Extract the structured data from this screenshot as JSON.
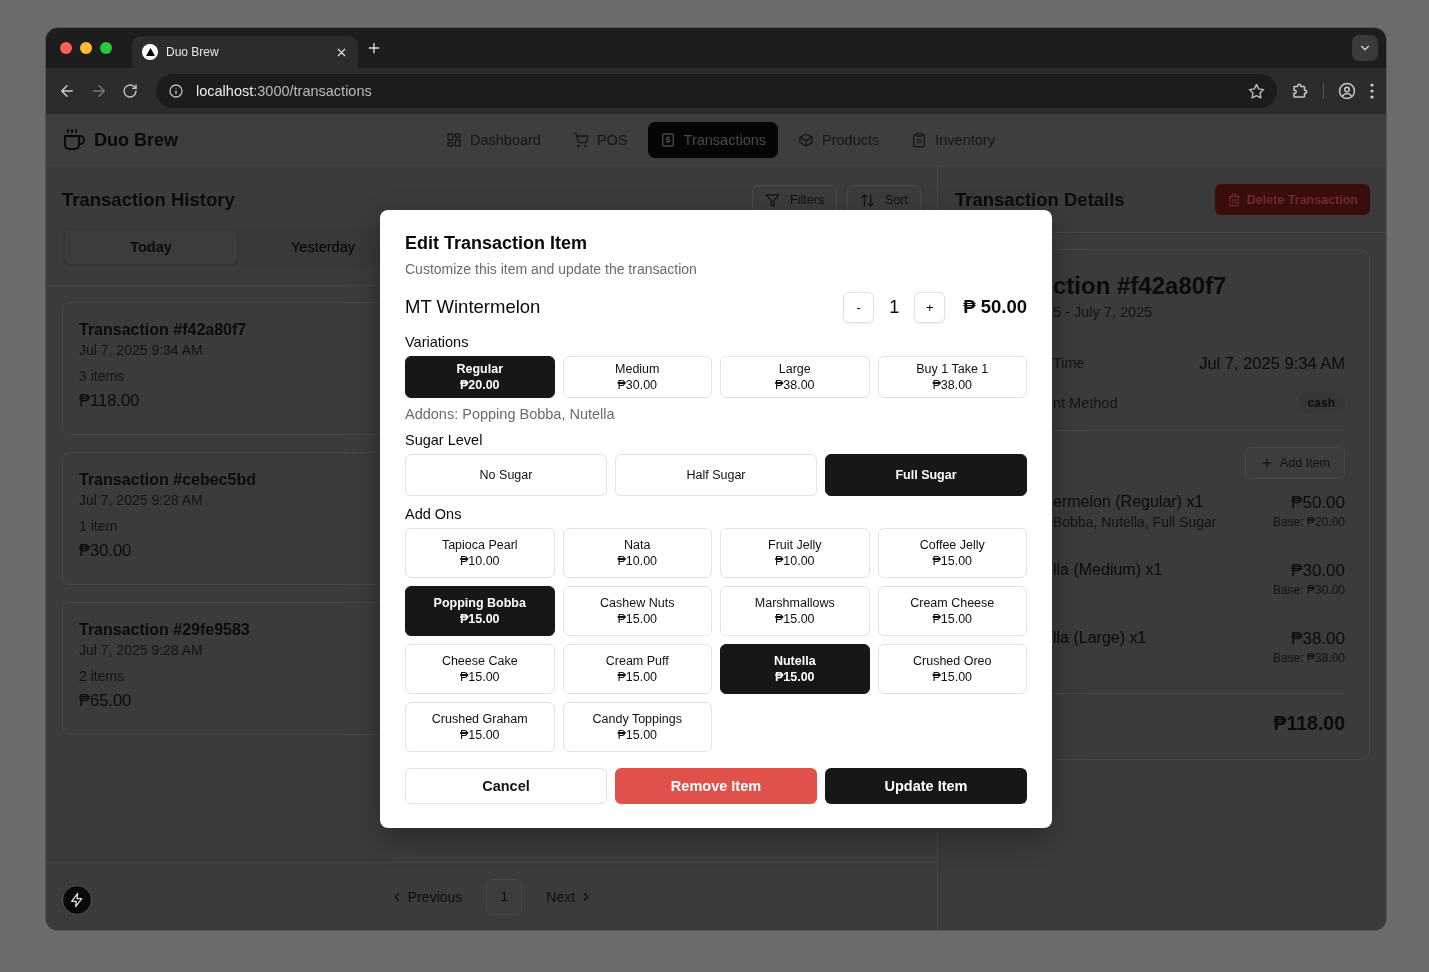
{
  "browser": {
    "tab_title": "Duo Brew",
    "url_host": "localhost",
    "url_path": ":3000/transactions"
  },
  "header": {
    "brand": "Duo Brew",
    "nav": [
      {
        "label": "Dashboard",
        "selected": false
      },
      {
        "label": "POS",
        "selected": false
      },
      {
        "label": "Transactions",
        "selected": true
      },
      {
        "label": "Products",
        "selected": false
      },
      {
        "label": "Inventory",
        "selected": false
      }
    ]
  },
  "history": {
    "title": "Transaction History",
    "filters": "Filters",
    "sort": "Sort",
    "tabs": [
      {
        "label": "Today",
        "selected": true
      },
      {
        "label": "Yesterday",
        "selected": false
      }
    ],
    "transactions": [
      {
        "title": "Transaction #f42a80f7",
        "date": "Jul 7, 2025 9:34 AM",
        "count": "3 items",
        "total": "₱118.00"
      },
      {
        "title": "Transaction #cebec5bd",
        "date": "Jul 7, 2025 9:28 AM",
        "count": "1 item",
        "total": "₱30.00"
      },
      {
        "title": "Transaction #29fe9583",
        "date": "Jul 7, 2025 9:28 AM",
        "count": "2 items",
        "total": "₱65.00"
      }
    ],
    "pagination": {
      "previous": "Previous",
      "page": "1",
      "next": "Next"
    }
  },
  "details": {
    "title": "Transaction Details",
    "delete": "Delete Transaction",
    "heading": "ction #f42a80f7",
    "subheading": "5 - July 7, 2025",
    "rows": [
      {
        "kind": "text",
        "label": "Time",
        "value": "Jul 7, 2025 9:34 AM"
      },
      {
        "kind": "badge",
        "label": "nt Method",
        "value": "cash"
      }
    ],
    "add_item": "Add Item",
    "items": [
      {
        "name": "ermelon (Regular) x1",
        "detail": "Bobba, Nutella, Full Sugar",
        "price": "₱50.00",
        "base": "Base: ₱20.00"
      },
      {
        "name": "lla (Medium) x1",
        "price": "₱30.00",
        "base": "Base: ₱30.00"
      },
      {
        "name": "lla (Large) x1",
        "price": "₱38.00",
        "base": "Base: ₱38.00"
      }
    ],
    "total": "₱118.00"
  },
  "modal": {
    "title": "Edit Transaction Item",
    "subtitle": "Customize this item and update the transaction",
    "product": "MT Wintermelon",
    "decrement": "-",
    "quantity": "1",
    "increment": "+",
    "price": "₱ 50.00",
    "variations_label": "Variations",
    "variations": [
      {
        "name": "Regular",
        "price": "₱20.00",
        "selected": true
      },
      {
        "name": "Medium",
        "price": "₱30.00",
        "selected": false
      },
      {
        "name": "Large",
        "price": "₱38.00",
        "selected": false
      },
      {
        "name": "Buy 1 Take 1",
        "price": "₱38.00",
        "selected": false
      }
    ],
    "addons_summary": "Addons: Popping Bobba, Nutella",
    "sugar_label": "Sugar Level",
    "sugar": [
      {
        "label": "No Sugar",
        "selected": false
      },
      {
        "label": "Half Sugar",
        "selected": false
      },
      {
        "label": "Full Sugar",
        "selected": true
      }
    ],
    "addons_label": "Add Ons",
    "addons": [
      {
        "name": "Tapioca Pearl",
        "price": "₱10.00",
        "selected": false
      },
      {
        "name": "Nata",
        "price": "₱10.00",
        "selected": false
      },
      {
        "name": "Fruit Jelly",
        "price": "₱10.00",
        "selected": false
      },
      {
        "name": "Coffee Jelly",
        "price": "₱15.00",
        "selected": false
      },
      {
        "name": "Popping Bobba",
        "price": "₱15.00",
        "selected": true
      },
      {
        "name": "Cashew Nuts",
        "price": "₱15.00",
        "selected": false
      },
      {
        "name": "Marshmallows",
        "price": "₱15.00",
        "selected": false
      },
      {
        "name": "Cream Cheese",
        "price": "₱15.00",
        "selected": false
      },
      {
        "name": "Cheese Cake",
        "price": "₱15.00",
        "selected": false
      },
      {
        "name": "Cream Puff",
        "price": "₱15.00",
        "selected": false
      },
      {
        "name": "Nutella",
        "price": "₱15.00",
        "selected": true
      },
      {
        "name": "Crushed Oreo",
        "price": "₱15.00",
        "selected": false
      },
      {
        "name": "Crushed Graham",
        "price": "₱15.00",
        "selected": false
      },
      {
        "name": "Candy Toppings",
        "price": "₱15.00",
        "selected": false
      }
    ],
    "buttons": [
      {
        "kind": "secondary",
        "label": "Cancel"
      },
      {
        "kind": "danger",
        "label": "Remove Item"
      },
      {
        "kind": "primary",
        "label": "Update Item"
      }
    ]
  }
}
